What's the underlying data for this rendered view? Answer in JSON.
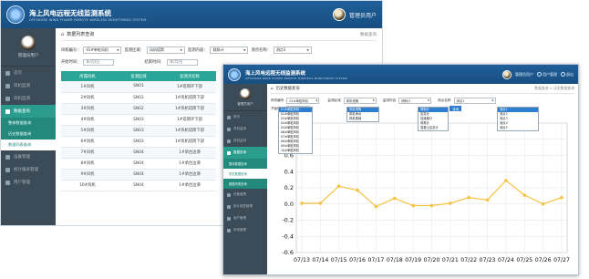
{
  "app": {
    "title_zh": "海上风电远程无线监测系统",
    "title_en": "OFFSHORE WIND POWER REMOTE WIRELESS MONITORING SYSTEM"
  },
  "user": {
    "greeting": "管理员用户",
    "top_links": [
      "用户管理",
      "退出"
    ]
  },
  "sidebar": {
    "items": [
      "首页",
      "风机监测",
      "风机监测",
      "数据查询",
      "设备管理",
      "统计报表管理",
      "用户管理",
      "系统管理"
    ],
    "sub": [
      "整体数据查询",
      "历史数据查询",
      "数据列表查询"
    ]
  },
  "back": {
    "page_title": "数据列表查询",
    "breadcrumb_right": "数据查询",
    "filters": {
      "fan_label": "风机编号：",
      "fan_value": "01#单桩风机",
      "region_label": "监测区域：",
      "region_value": "风机塔筒",
      "content_label": "监测内容：",
      "content_value": "倾斜计",
      "point_label": "测点名称：",
      "point_value": "测点1",
      "start_label": "开始时间：",
      "start_value": "年/月/日",
      "end_label": "结束时间：",
      "end_value": "年/月/日"
    },
    "table": {
      "headers": [
        "所属风机",
        "监测区域",
        "监测点名称"
      ],
      "rows": [
        [
          "1#风机",
          "SN01",
          "1#塔筒环下部"
        ],
        [
          "2#风机",
          "SN01",
          "1#风机塔筒下部"
        ],
        [
          "3#风机",
          "SN02",
          "1#风机塔筒下部"
        ],
        [
          "4#风机",
          "SN03",
          "1#塔筒环下部"
        ],
        [
          "5#风机",
          "SN03",
          "1#风机塔筒下部"
        ],
        [
          "6#风机",
          "SN03",
          "1#风机塔筒下部"
        ],
        [
          "7#风机",
          "SN04",
          "1#承台边滑"
        ],
        [
          "8#风机",
          "SN04",
          "1#承台边滑"
        ],
        [
          "9#风机",
          "SN04",
          "1#承台边滑"
        ],
        [
          "10#风机",
          "SN04",
          "1#承台边滑"
        ]
      ]
    }
  },
  "front": {
    "page_title": "历史数据查询",
    "breadcrumb_right": "数据查询 > 历史数据查询",
    "filters": {
      "fan_label": "风机编号",
      "fan_value": "01#单桩风机",
      "region_label": "监测区域",
      "region_value": "风机塔筒",
      "content_label": "监测内容",
      "content_value": "倾斜计",
      "point_label": "测点名称",
      "point_value": "测点1",
      "start_label": "开始时间",
      "query_button": "查询"
    },
    "dropdowns": {
      "fan": [
        "01#单桩风机",
        "02#单桩风机",
        "03#单桩风机",
        "04#单桩风机",
        "05#单桩风机",
        "06#单桩风机",
        "07#单桩风机",
        "08#单桩风机",
        "09#单桩风机",
        "10#单桩风机"
      ],
      "region": [
        "风机塔筒",
        "风机承台",
        "风机基础"
      ],
      "content": [
        "倾斜计",
        "应变计",
        "加速度计",
        "倾角计",
        "混凝土应变计"
      ],
      "point": [
        "测点1",
        "测点2",
        "测点3",
        "测点4",
        "测点5"
      ]
    }
  },
  "colors": {
    "header_blue": "#1f5f9a",
    "sidebar": "#3b4b58",
    "teal": "#2a9d8f",
    "line": "#f5c242"
  },
  "chart_data": {
    "type": "line",
    "title": "",
    "xlabel": "",
    "ylabel": "",
    "x": [
      "07/13",
      "07/14",
      "07/15",
      "07/16",
      "07/17",
      "07/18",
      "07/19",
      "07/20",
      "07/21",
      "07/22",
      "07/23",
      "07/24",
      "07/25",
      "07/26",
      "07/27"
    ],
    "series": [
      {
        "values": [
          0.01,
          0.01,
          0.22,
          0.17,
          -0.03,
          0.07,
          -0.02,
          -0.02,
          0.01,
          0.08,
          0.05,
          0.29,
          0.11,
          0.0,
          0.08
        ]
      }
    ],
    "ylim": [
      -0.6,
      1.0
    ],
    "yticks": [
      1.0,
      0.8,
      0.6,
      0.4,
      0.2,
      0.0,
      -0.2,
      -0.4,
      -0.6
    ],
    "grid": true
  }
}
